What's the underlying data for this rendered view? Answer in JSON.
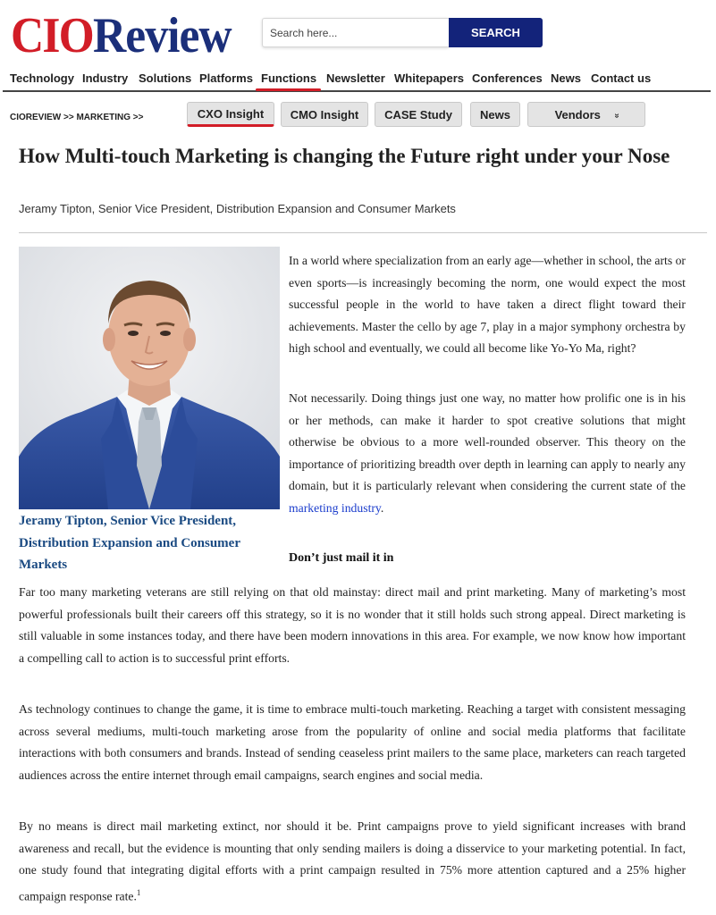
{
  "logo": {
    "part1": "CIO",
    "part2": "Review"
  },
  "search": {
    "placeholder": "Search here...",
    "button": "SEARCH"
  },
  "nav": [
    "Technology",
    "Industry",
    "Solutions",
    "Platforms",
    "Functions",
    "Newsletter",
    "Whitepapers",
    "Conferences",
    "News",
    "Contact us"
  ],
  "nav_active": "Functions",
  "breadcrumb": "CIOREVIEW >> MARKETING >>",
  "tabs": [
    "CXO Insight",
    "CMO Insight",
    "CASE Study",
    "News",
    "Vendors"
  ],
  "tab_active": "CXO Insight",
  "vendors_chevron": "»",
  "accent_colors": {
    "red": "#d21d27",
    "navy": "#13237a",
    "caption_blue": "#1a4a82",
    "link_blue": "#1a3ccc"
  },
  "article": {
    "title": "How Multi-touch Marketing is changing the Future right under your Nose",
    "byline": "Jeramy Tipton, Senior Vice President, Distribution Expansion and Consumer Markets",
    "photo_caption": "Jeramy Tipton, Senior Vice President, Distribution Expansion and Consumer Markets",
    "p1": "In a world where specialization from an early age—whether in school, the arts or even sports—is increasingly becoming the norm, one would expect the most successful people in the world to have taken a direct flight toward their achievements. Master the cello by age 7, play in a major symphony orchestra by high school and eventually, we could all become like Yo-Yo Ma, right?",
    "p2_text": "Not necessarily. Doing things just one way, no matter how prolific one is in his or her methods, can make it harder to spot creative solutions that might otherwise be obvious to a more well-rounded observer. This theory on the importance of prioritizing breadth over depth in learning can apply to nearly any domain, but it is particularly relevant when considering the current state of the",
    "p2_link": "marketing industry",
    "p2_end": ".",
    "subhead": "Don’t just mail it in",
    "p3": "Far too many marketing veterans are still relying on that old mainstay: direct mail and print marketing. Many of marketing’s most powerful professionals built their careers off this strategy, so it is no wonder that it still holds such strong appeal. Direct marketing is still valuable in some instances today, and there have been modern innovations in this area. For example, we now know how important a compelling call to action is to successful print efforts.",
    "p4": "As technology continues to change the game, it is time to embrace multi-touch marketing. Reaching a target with consistent messaging across several mediums, multi-touch marketing arose from the popularity of online and social media platforms that facilitate interactions with both consumers and brands. Instead of sending ceaseless print mailers to the same place, marketers can reach targeted audiences across the entire internet through email campaigns, search engines and social media.",
    "p5_text": "By no means is direct mail marketing extinct, nor should it be. Print campaigns prove to yield significant increases with brand awareness and recall, but the evidence is mounting that only sending mailers is doing a disservice to your marketing potential. In fact, one study found that integrating digital efforts with a print campaign resulted in 75% more attention captured and a 25% higher campaign response rate.",
    "p5_footnote": "1"
  }
}
